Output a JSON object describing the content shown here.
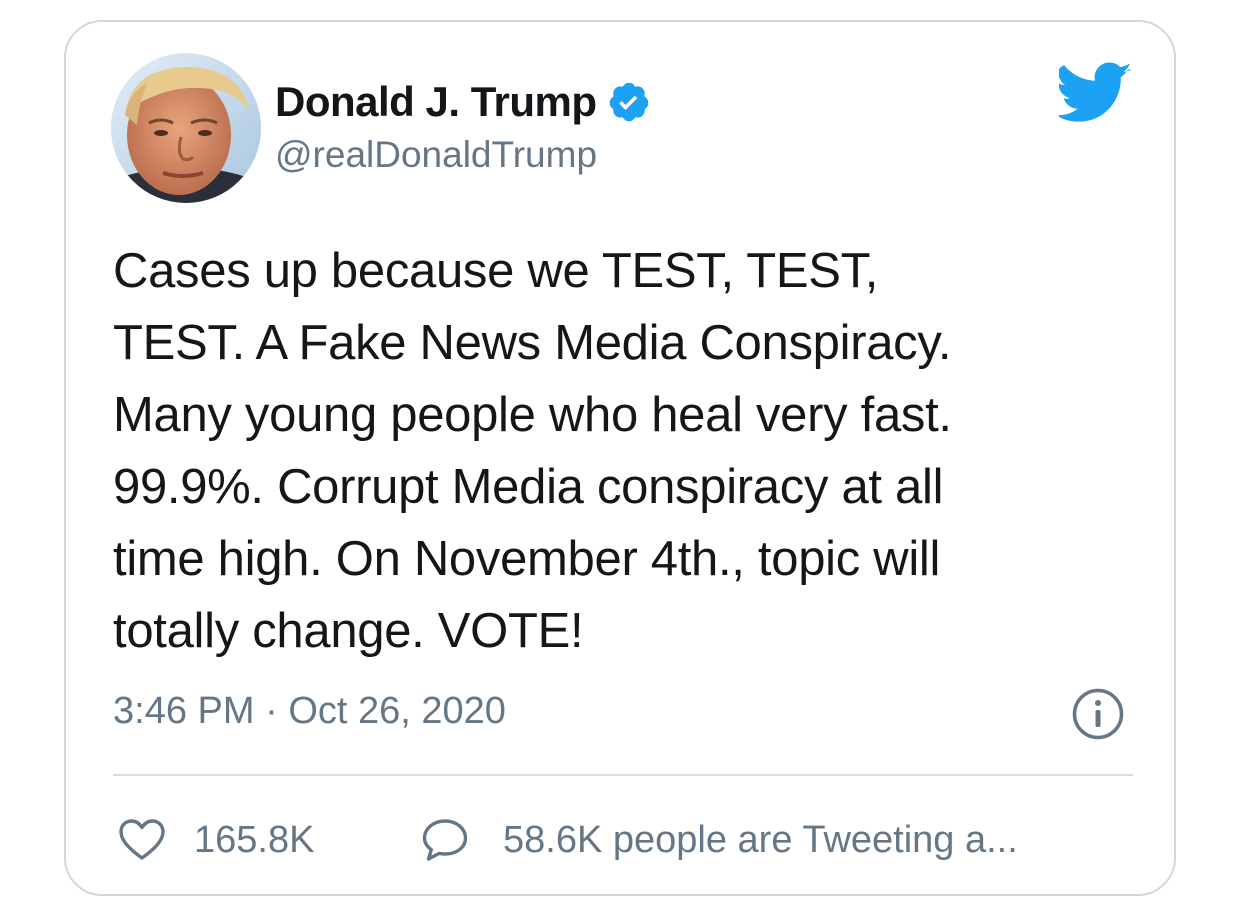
{
  "tweet": {
    "display_name": "Donald J. Trump",
    "handle": "@realDonaldTrump",
    "verified": true,
    "text": "Cases up because we TEST, TEST,\nTEST. A Fake News Media Conspiracy.\nMany young people who heal very fast.\n99.9%. Corrupt Media conspiracy at all\ntime high. On November 4th., topic will\ntotally change. VOTE!",
    "time": "3:46 PM",
    "separator": "·",
    "date": "Oct 26, 2020",
    "likes": "165.8K",
    "conversation": "58.6K people are Tweeting a..."
  },
  "icons": {
    "avatar": "profile-photo",
    "verified": "verified-badge-icon",
    "brand": "twitter-bird-icon",
    "info": "info-icon",
    "like": "heart-outline-icon",
    "reply": "speech-bubble-icon"
  },
  "colors": {
    "brand": "#1da1f2",
    "text_primary": "#14171a",
    "text_secondary": "#657786",
    "border": "#d0d8de"
  }
}
